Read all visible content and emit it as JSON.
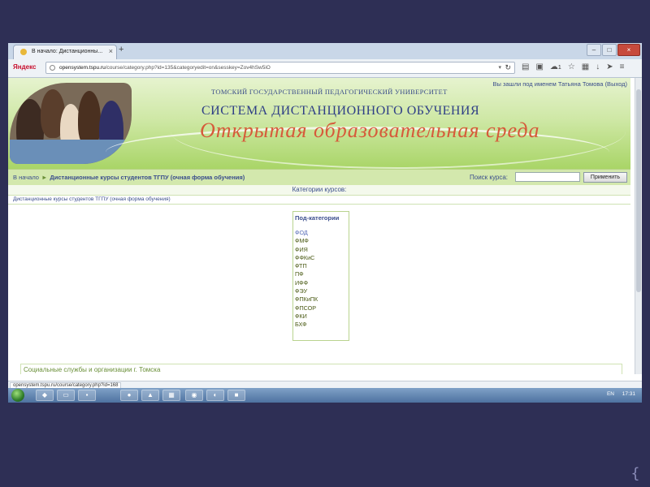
{
  "browser": {
    "tab_title": "В начало: Дистанционны...",
    "new_tab": "+",
    "search_engine_logo": "Яндекс",
    "url_host": "opensystem.tspu.ru",
    "url_prefix": "",
    "url_path": "/course/category.php?id=135&categoryedit=on&sesskey=Zov4hSw5iO",
    "notification_count": "1",
    "status_url": "opensystem.tspu.ru/course/category.php?id=168"
  },
  "header": {
    "university": "ТОМСКИЙ ГОСУДАРСТВЕННЫЙ ПЕДАГОГИЧЕСКИЙ УНИВЕРСИТЕТ",
    "system_title": "СИСТЕМА ДИСТАНЦИОННОГО ОБУЧЕНИЯ",
    "slogan": "Открытая образовательная среда",
    "login_prefix": "Вы зашли под именем",
    "login_user": "Татьяна Томова",
    "logout": "(Выход)"
  },
  "breadcrumb": {
    "home": "В начало",
    "separator": "►",
    "current": "Дистанционные курсы студентов ТГПУ (очная форма обучения)"
  },
  "search": {
    "label": "Поиск курса:",
    "value": "",
    "button": "Применить"
  },
  "categories_heading": "Категории курсов:",
  "category_path": "Дистанционные курсы студентов ТГПУ (очная форма обучения)",
  "subcategories": {
    "heading": "Под-категории",
    "items": [
      "ФОД",
      "ФМФ",
      "ФИЯ",
      "ФФКиС",
      "ФТП",
      "ПФ",
      "ИФФ",
      "ФЭУ",
      "ФПКиПК",
      "ФПСОР",
      "ФКИ",
      "БХФ"
    ]
  },
  "social_section": "Социальные службы и организации г. Томска",
  "taskbar": {
    "language": "EN",
    "clock": "17:31"
  },
  "colors": {
    "link_blue": "#3a4d8c",
    "banner_green": "#a9d567",
    "slogan_orange": "#d65a3a",
    "slide_background": "#2e2f55"
  }
}
